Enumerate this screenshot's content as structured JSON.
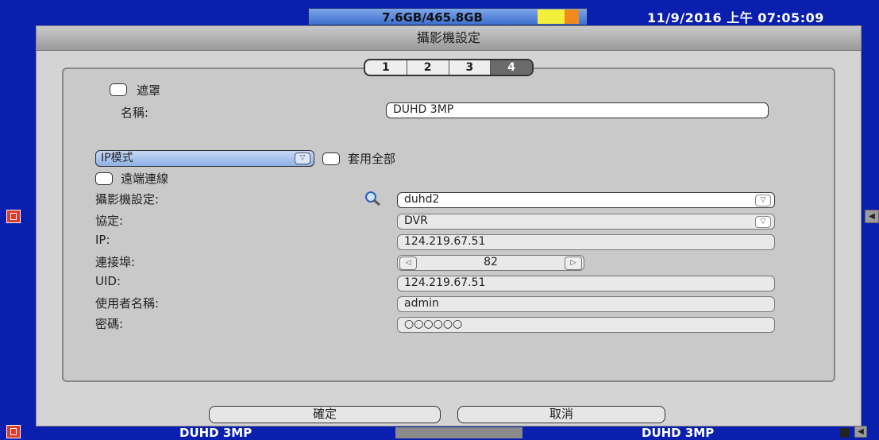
{
  "status": {
    "storage": "7.6GB/465.8GB",
    "datetime": "11/9/2016 上午 07:05:09"
  },
  "dialog": {
    "title": "攝影機設定",
    "tabs": [
      "1",
      "2",
      "3",
      "4"
    ],
    "active_tab": "4",
    "mask_label": "遮罩",
    "name_label": "名稱:",
    "name_value": "DUHD 3MP",
    "mode_value": "IP模式",
    "apply_all_label": "套用全部",
    "remote_label": "遠端連線",
    "camera_setting_label": "攝影機設定:",
    "camera_setting_value": "duhd2",
    "protocol_label": "協定:",
    "protocol_value": "DVR",
    "ip_label": "IP:",
    "ip_value": "124.219.67.51",
    "port_label": "連接埠:",
    "port_value": "82",
    "uid_label": "UID:",
    "uid_value": "124.219.67.51",
    "username_label": "使用者名稱:",
    "username_value": "admin",
    "password_label": "密碼:",
    "password_value": "○○○○○○",
    "ok_label": "確定",
    "cancel_label": "取消"
  },
  "bottom": {
    "left_channel": "DUHD 3MP",
    "right_channel": "DUHD 3MP"
  },
  "colors": {
    "background": "#0a1fae",
    "dialog": "#d4d4d4",
    "accent_red": "#e23a2a"
  }
}
